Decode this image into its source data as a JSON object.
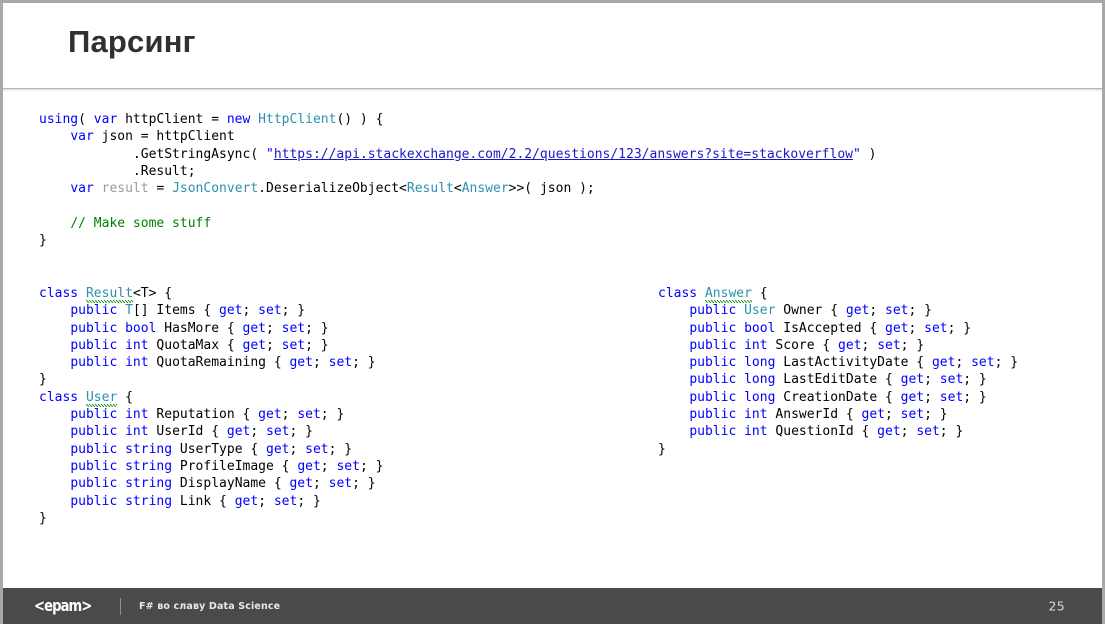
{
  "slide": {
    "title": "Парсинг",
    "page_number": "25"
  },
  "footer": {
    "logo": "<epam>",
    "tagline": "F# во славу Data Science"
  },
  "code": {
    "main_block": {
      "lines": [
        "using( var httpClient = new HttpClient() ) {",
        "    var json = httpClient",
        "            .GetStringAsync( \"https://api.stackexchange.com/2.2/questions/123/answers?site=stackoverflow\" )",
        "            .Result;",
        "    var result = JsonConvert.DeserializeObject<Result<Answer>>( json );",
        "",
        "    // Make some stuff",
        "}"
      ],
      "url": "https://api.stackexchange.com/2.2/questions/123/answers?site=stackoverflow",
      "comment": "// Make some stuff"
    },
    "class_result": {
      "declaration": "class Result<T> {",
      "name": "Result",
      "members": [
        "    public T[] Items { get; set; }",
        "    public bool HasMore { get; set; }",
        "    public int QuotaMax { get; set; }",
        "    public int QuotaRemaining { get; set; }"
      ],
      "close": "}"
    },
    "class_user": {
      "declaration": "class User {",
      "name": "User",
      "members": [
        "    public int Reputation { get; set; }",
        "    public int UserId { get; set; }",
        "    public string UserType { get; set; }",
        "    public string ProfileImage { get; set; }",
        "    public string DisplayName { get; set; }",
        "    public string Link { get; set; }"
      ],
      "close": "}"
    },
    "class_answer": {
      "declaration": "class Answer {",
      "name": "Answer",
      "members": [
        "    public User Owner { get; set; }",
        "    public bool IsAccepted { get; set; }",
        "    public int Score { get; set; }",
        "    public long LastActivityDate { get; set; }",
        "    public long LastEditDate { get; set; }",
        "    public long CreationDate { get; set; }",
        "    public int AnswerId { get; set; }",
        "    public int QuestionId { get; set; }"
      ],
      "close": "}"
    }
  },
  "colors": {
    "keyword": "#0000ff",
    "type": "#2b91af",
    "comment": "#008000",
    "link": "#1a19c8",
    "footer_bg": "#4a4a4d",
    "title": "#2f3032"
  }
}
